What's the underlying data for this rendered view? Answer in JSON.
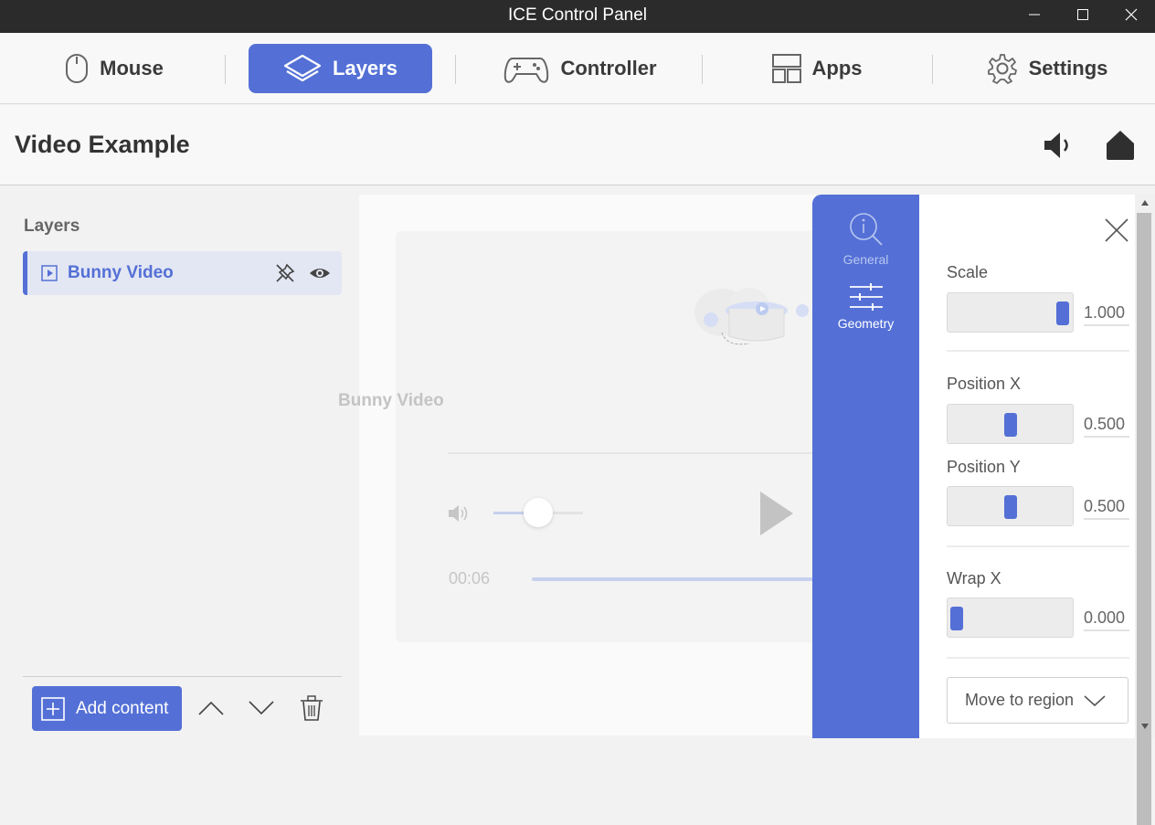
{
  "window": {
    "title": "ICE Control Panel"
  },
  "nav": {
    "tabs": [
      {
        "label": "Mouse"
      },
      {
        "label": "Layers"
      },
      {
        "label": "Controller"
      },
      {
        "label": "Apps"
      },
      {
        "label": "Settings"
      }
    ],
    "active_tab": "Layers"
  },
  "page": {
    "title": "Video Example"
  },
  "layers": {
    "title": "Layers",
    "items": [
      {
        "label": "Bunny Video",
        "icon": "video-play-icon"
      }
    ],
    "add_label": "Add content"
  },
  "preview": {
    "video_name": "Bunny Video",
    "time": "00:06",
    "volume_level": 0.5
  },
  "side_tabs": {
    "general": "General",
    "geometry": "Geometry"
  },
  "geometry": {
    "scale_label": "Scale",
    "scale_value": "1.000",
    "scale_level": 0.92,
    "posx_label": "Position X",
    "posx_value": "0.500",
    "posx_level": 0.5,
    "posy_label": "Position Y",
    "posy_value": "0.500",
    "posy_level": 0.5,
    "wrapx_label": "Wrap X",
    "wrapx_value": "0.000",
    "wrapx_level": 0.07,
    "region_label": "Move to region"
  },
  "colors": {
    "accent": "#5470d6",
    "titlebar": "#2b2b2b"
  }
}
